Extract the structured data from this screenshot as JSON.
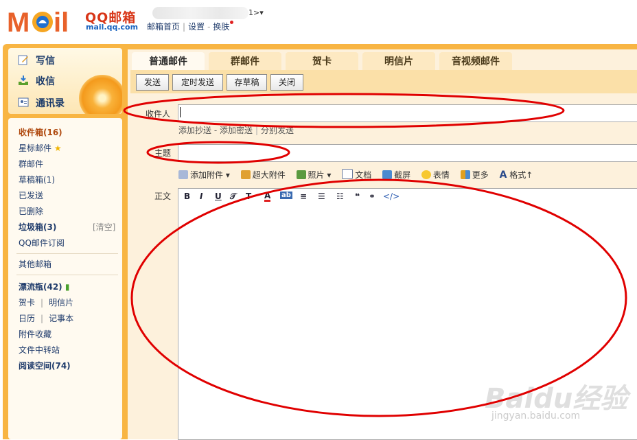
{
  "header": {
    "logo_text": "MOil",
    "brand": "QQ邮箱",
    "domain": "mail.qq.com",
    "user_suffix": "1>▾",
    "links": [
      "邮箱首页",
      "设置",
      "换肤"
    ]
  },
  "sidebar": {
    "primary": [
      {
        "label": "写信",
        "icon": "compose-icon"
      },
      {
        "label": "收信",
        "icon": "inbox-download-icon"
      },
      {
        "label": "通讯录",
        "icon": "contacts-icon"
      }
    ],
    "items": [
      {
        "label": "收件箱(16)",
        "bold": true
      },
      {
        "label": "星标邮件",
        "star": true
      },
      {
        "label": "群邮件"
      },
      {
        "label": "草稿箱(1)"
      },
      {
        "label": "已发送"
      },
      {
        "label": "已删除"
      },
      {
        "label": "垃圾箱(3)",
        "bold": true,
        "action": "[清空]"
      },
      {
        "label": "QQ邮件订阅"
      },
      {
        "label": "其他邮箱"
      },
      {
        "label": "漂流瓶(42)",
        "bold": true,
        "bottle": true
      },
      {
        "label": "贺卡",
        "pair": "明信片"
      },
      {
        "label": "日历",
        "pair": "记事本"
      },
      {
        "label": "附件收藏"
      },
      {
        "label": "文件中转站"
      },
      {
        "label": "阅读空间(74)",
        "bold": true
      }
    ]
  },
  "tabs": [
    "普通邮件",
    "群邮件",
    "贺卡",
    "明信片",
    "音视频邮件"
  ],
  "toolbar": {
    "send": "发送",
    "scheduled": "定时发送",
    "draft": "存草稿",
    "close": "关闭"
  },
  "compose": {
    "to_label": "收件人",
    "to_value": "",
    "to_links": [
      "添加抄送",
      "添加密送",
      "分别发送"
    ],
    "subject_label": "主题",
    "subject_value": "",
    "body_label": "正文"
  },
  "attach_tools": [
    "添加附件",
    "超大附件",
    "照片",
    "文档",
    "截屏",
    "表情",
    "更多",
    "格式↑"
  ],
  "editor_tools": [
    "B",
    "I",
    "U",
    "𝒯",
    "T",
    "A",
    "ab",
    "≡",
    "☰",
    "☷",
    "❝",
    "⚭",
    "</>"
  ],
  "watermark": {
    "main": "Baidu经验",
    "sub": "jingyan.baidu.com"
  },
  "colors": {
    "frame": "#f8b543",
    "tab": "#fde9c2",
    "annotation": "#e00000",
    "brand_red": "#d83618",
    "link_blue": "#1f3b6b"
  }
}
